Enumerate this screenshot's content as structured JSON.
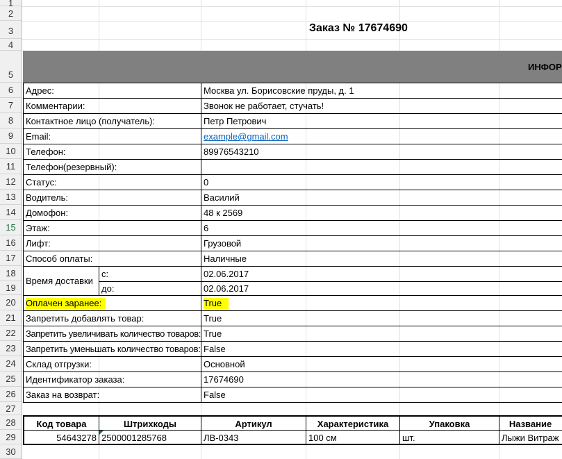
{
  "row_numbers": [
    "1",
    "2",
    "3",
    "4",
    "5",
    "6",
    "7",
    "8",
    "9",
    "10",
    "11",
    "12",
    "13",
    "14",
    "15",
    "16",
    "17",
    "18",
    "19",
    "20",
    "21",
    "22",
    "23",
    "24",
    "25",
    "26",
    "27",
    "28",
    "29",
    "30"
  ],
  "title": "Заказ № 17674690",
  "banner": "ИНФОР",
  "info": [
    {
      "label": "Адрес:",
      "value": "Москва ул. Борисовские пруды, д. 1"
    },
    {
      "label": "Комментарии:",
      "value": "Звонок не работает, стучать!"
    },
    {
      "label": "Контактное лицо (получатель):",
      "value": "Петр Петрович"
    },
    {
      "label": "Email:",
      "value": "example@gmail.com"
    },
    {
      "label": "Телефон:",
      "value": "89976543210"
    },
    {
      "label": "Телефон(резервный):",
      "value": ""
    },
    {
      "label": "Статус:",
      "value": "0"
    },
    {
      "label": "Водитель:",
      "value": "Василий"
    },
    {
      "label": "Домофон:",
      "value": "48 к 2569"
    },
    {
      "label": "Этаж:",
      "value": "6"
    },
    {
      "label": "Лифт:",
      "value": "Грузовой"
    },
    {
      "label": "Способ оплаты:",
      "value": "Наличные"
    }
  ],
  "delivery": {
    "label": "Время доставки",
    "from_label": "с:",
    "from_value": "02.06.2017",
    "to_label": "до:",
    "to_value": "02.06.2017"
  },
  "info2": [
    {
      "label": "Оплачен заранее:",
      "value": "True"
    },
    {
      "label": "Запретить добавлять товар:",
      "value": "True"
    },
    {
      "label": "Запретить увеличивать количество товаров:",
      "value": "True"
    },
    {
      "label": "Запретить уменьшать количество товаров:",
      "value": "False"
    },
    {
      "label": "Склад отгрузки:",
      "value": "Основной"
    },
    {
      "label": "Идентификатор заказа:",
      "value": "17674690"
    },
    {
      "label": "Заказ на возврат:",
      "value": "False"
    }
  ],
  "products": {
    "headers": [
      "Код товара",
      "Штрихкоды",
      "Артикул",
      "Характеристика",
      "Упаковка",
      "Название"
    ],
    "row": [
      "54643278",
      "2500001285768",
      "ЛВ-0343",
      "100 см",
      "шт.",
      "Лыжи Витраж"
    ]
  },
  "highlight_color": "#ffff00",
  "link_color": "#0563c1"
}
